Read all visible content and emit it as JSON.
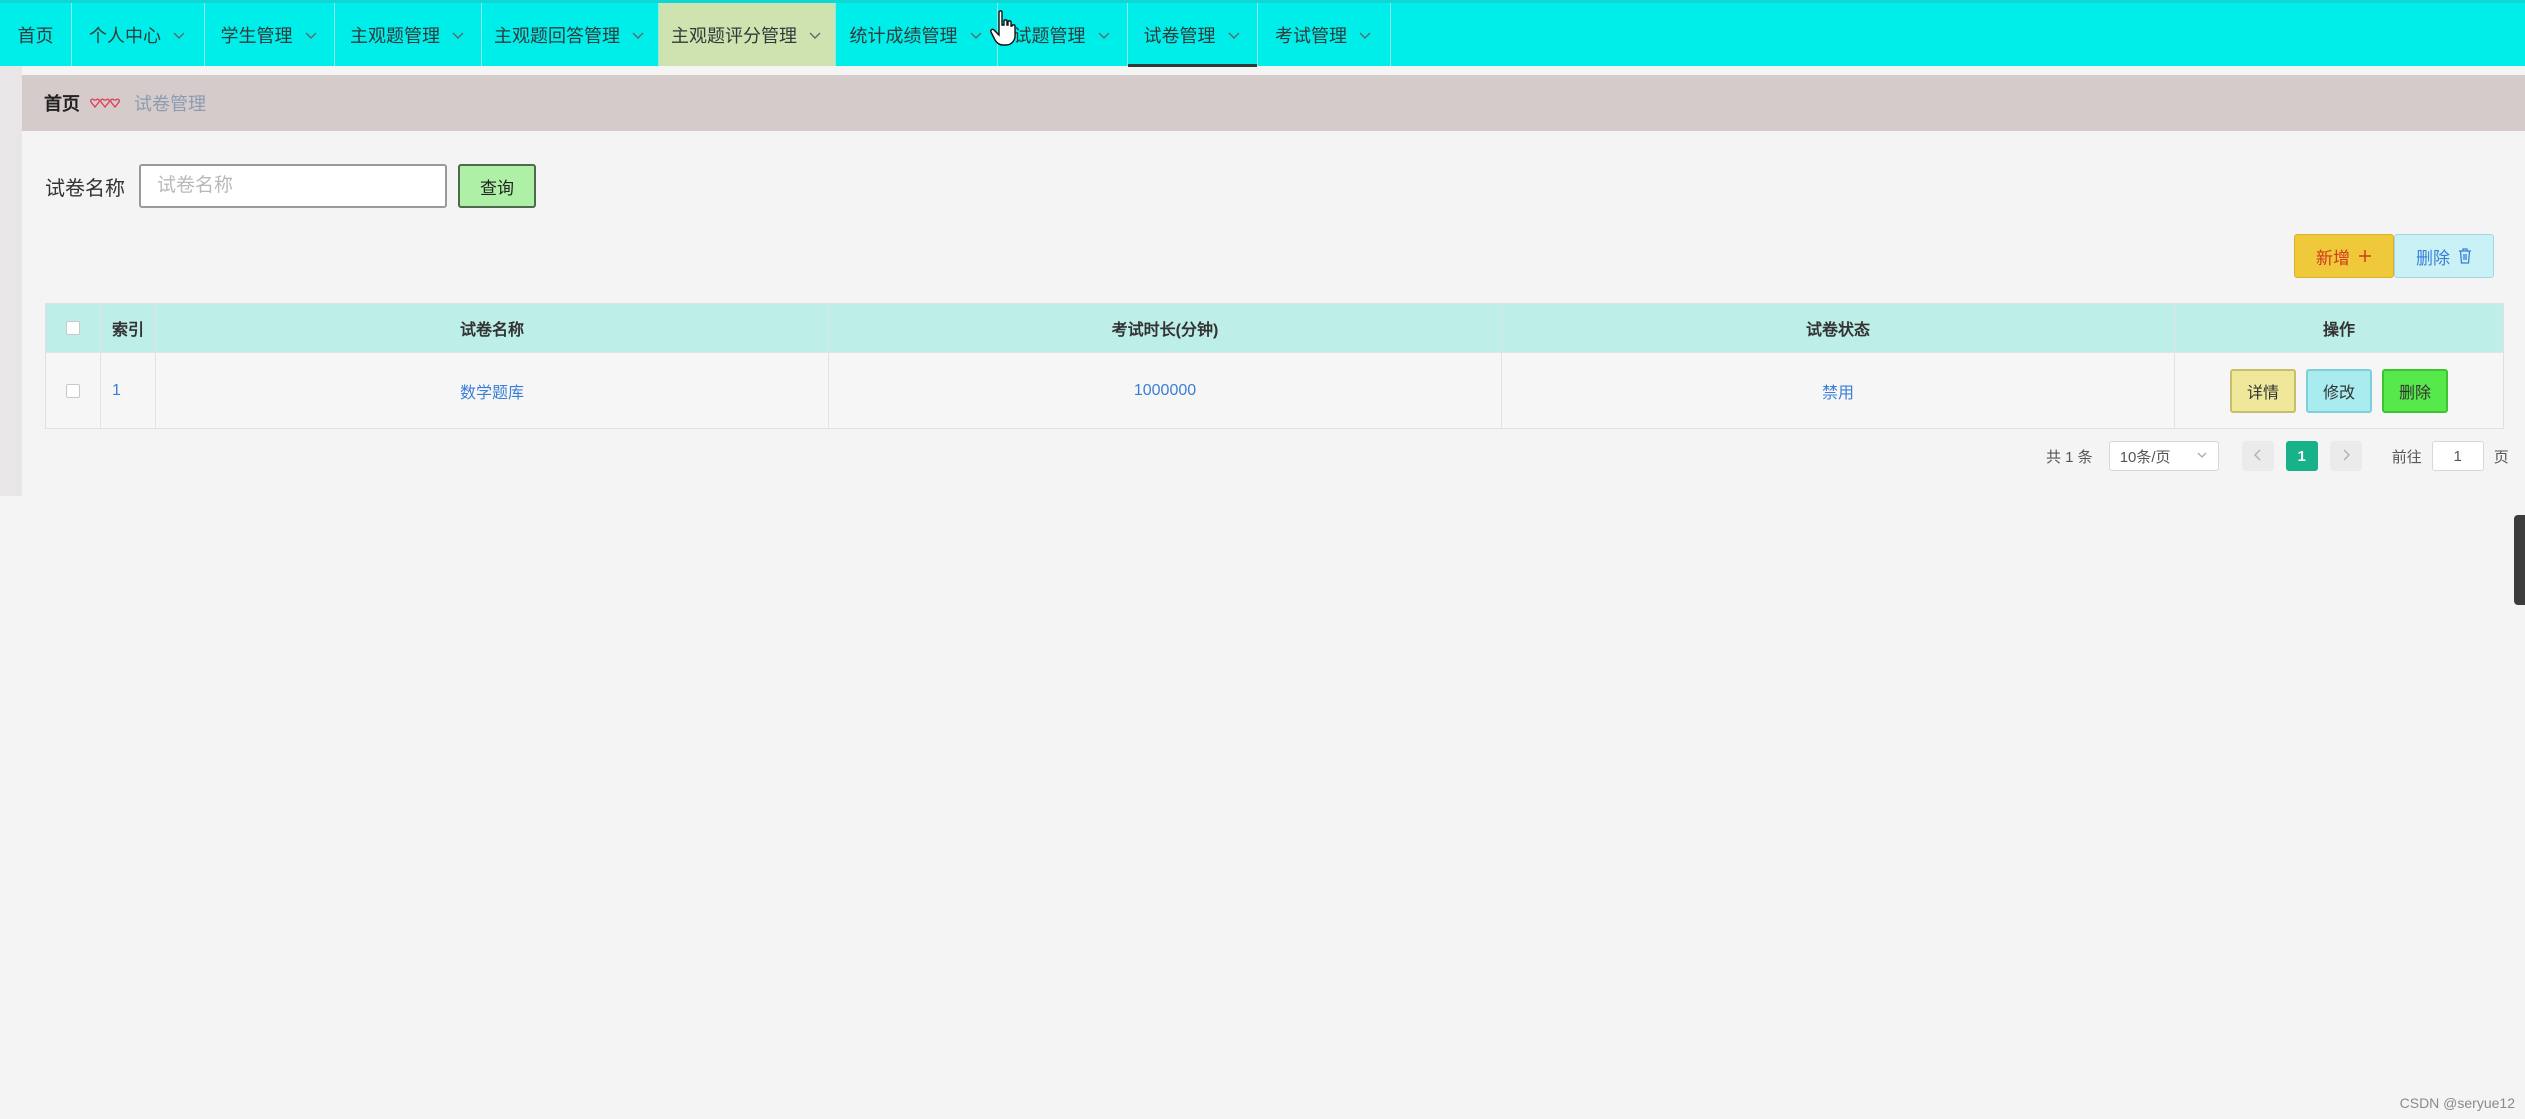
{
  "nav": {
    "items": [
      {
        "label": "首页",
        "dropdown": false
      },
      {
        "label": "个人中心",
        "dropdown": true
      },
      {
        "label": "学生管理",
        "dropdown": true
      },
      {
        "label": "主观题管理",
        "dropdown": true
      },
      {
        "label": "主观题回答管理",
        "dropdown": true
      },
      {
        "label": "主观题评分管理",
        "dropdown": true,
        "state": "hover"
      },
      {
        "label": "统计成绩管理",
        "dropdown": true
      },
      {
        "label": "试题管理",
        "dropdown": true
      },
      {
        "label": "试卷管理",
        "dropdown": true,
        "state": "active"
      },
      {
        "label": "考试管理",
        "dropdown": true
      }
    ]
  },
  "breadcrumb": {
    "home": "首页",
    "current": "试卷管理"
  },
  "search": {
    "label": "试卷名称",
    "placeholder": "试卷名称",
    "value": "",
    "button": "查询"
  },
  "actions": {
    "add": "新增",
    "delete": "删除"
  },
  "table": {
    "columns": [
      "索引",
      "试卷名称",
      "考试时长(分钟)",
      "试卷状态",
      "操作"
    ],
    "rows": [
      {
        "index": "1",
        "name": "数学题库",
        "duration": "1000000",
        "status": "禁用"
      }
    ],
    "row_actions": {
      "detail": "详情",
      "edit": "修改",
      "delete": "删除"
    }
  },
  "pagination": {
    "total_text": "共 1 条",
    "page_size": "10条/页",
    "current_page": "1",
    "goto_prefix": "前往",
    "goto_value": "1",
    "goto_suffix": "页"
  },
  "watermark": "CSDN @seryue12",
  "colors": {
    "nav_bg": "#00eeea",
    "breadcrumb_bg": "#d6cbcb",
    "table_header_bg": "#bdeee8",
    "accent_green": "#17b18a"
  }
}
